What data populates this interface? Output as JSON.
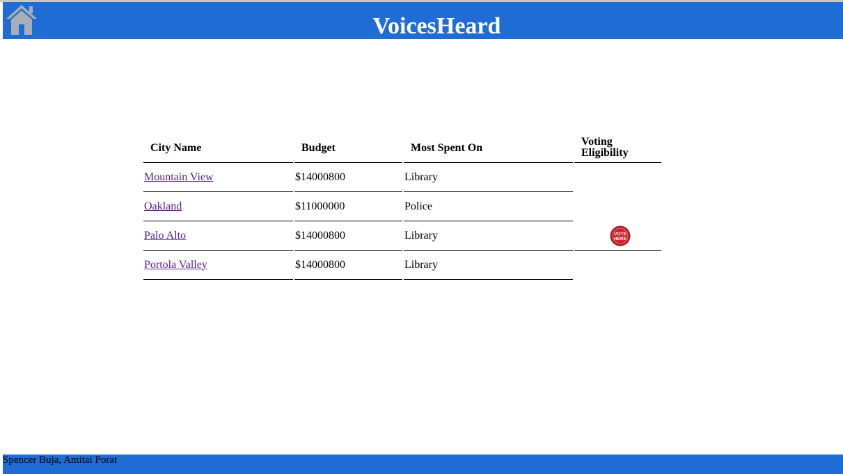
{
  "header": {
    "title": "VoicesHeard",
    "home_icon": "home-icon",
    "background_color": "#1e6cd4"
  },
  "table": {
    "columns": {
      "city": "City Name",
      "budget": "Budget",
      "most_spent": "Most Spent On",
      "voting_line1": "Voting",
      "voting_line2": "Eligibility"
    },
    "rows": [
      {
        "city": "Mountain View",
        "budget": "$14000800",
        "most_spent": "Library"
      },
      {
        "city": "Oakland",
        "budget": "$11000000",
        "most_spent": "Police"
      },
      {
        "city": "Palo Alto",
        "budget": "$14000800",
        "most_spent": "Library"
      },
      {
        "city": "Portola Valley",
        "budget": "$14000800",
        "most_spent": "Library"
      }
    ],
    "vote_badge": {
      "icon": "vote-here-icon",
      "line1": "VOTE",
      "line2": "HERE",
      "color": "#c9252c"
    }
  },
  "footer": {
    "credits": "Spencer Buja, Amitai Porat"
  }
}
